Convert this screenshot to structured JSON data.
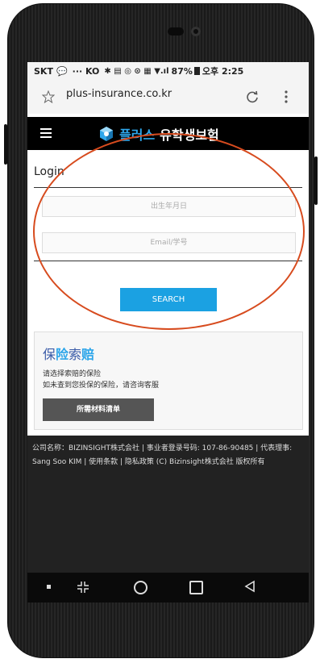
{
  "status_bar": {
    "carrier": "SKT",
    "indicators": "··· KO",
    "battery": "87%",
    "time": "오후 2:25"
  },
  "browser": {
    "url": "plus-insurance.co.kr"
  },
  "header": {
    "brand_accent": "플러스",
    "brand_main": "유학생보험"
  },
  "login": {
    "title": "Login",
    "birth_placeholder": "出生年月日",
    "email_placeholder": "Email/学号",
    "search_label": "SEARCH"
  },
  "claims": {
    "title_pre": "保",
    "title_accent": "险",
    "title_mid": "索",
    "title_end": "赔",
    "line1": "请选择索赔的保险",
    "line2": "如未查到您投保的保险，请咨询客服",
    "button_label": "所需材料清单"
  },
  "footer": {
    "text": "公司名称：BIZINSIGHT株式会社 | 事业者登录号码: 107-86-90485 | 代表理事: Sang Soo KIM | 使用条款 | 隐私政策 (C) Bizinsight株式会社 版权所有"
  },
  "colors": {
    "accent": "#1ba1e2",
    "annotation": "#d74b1e"
  }
}
